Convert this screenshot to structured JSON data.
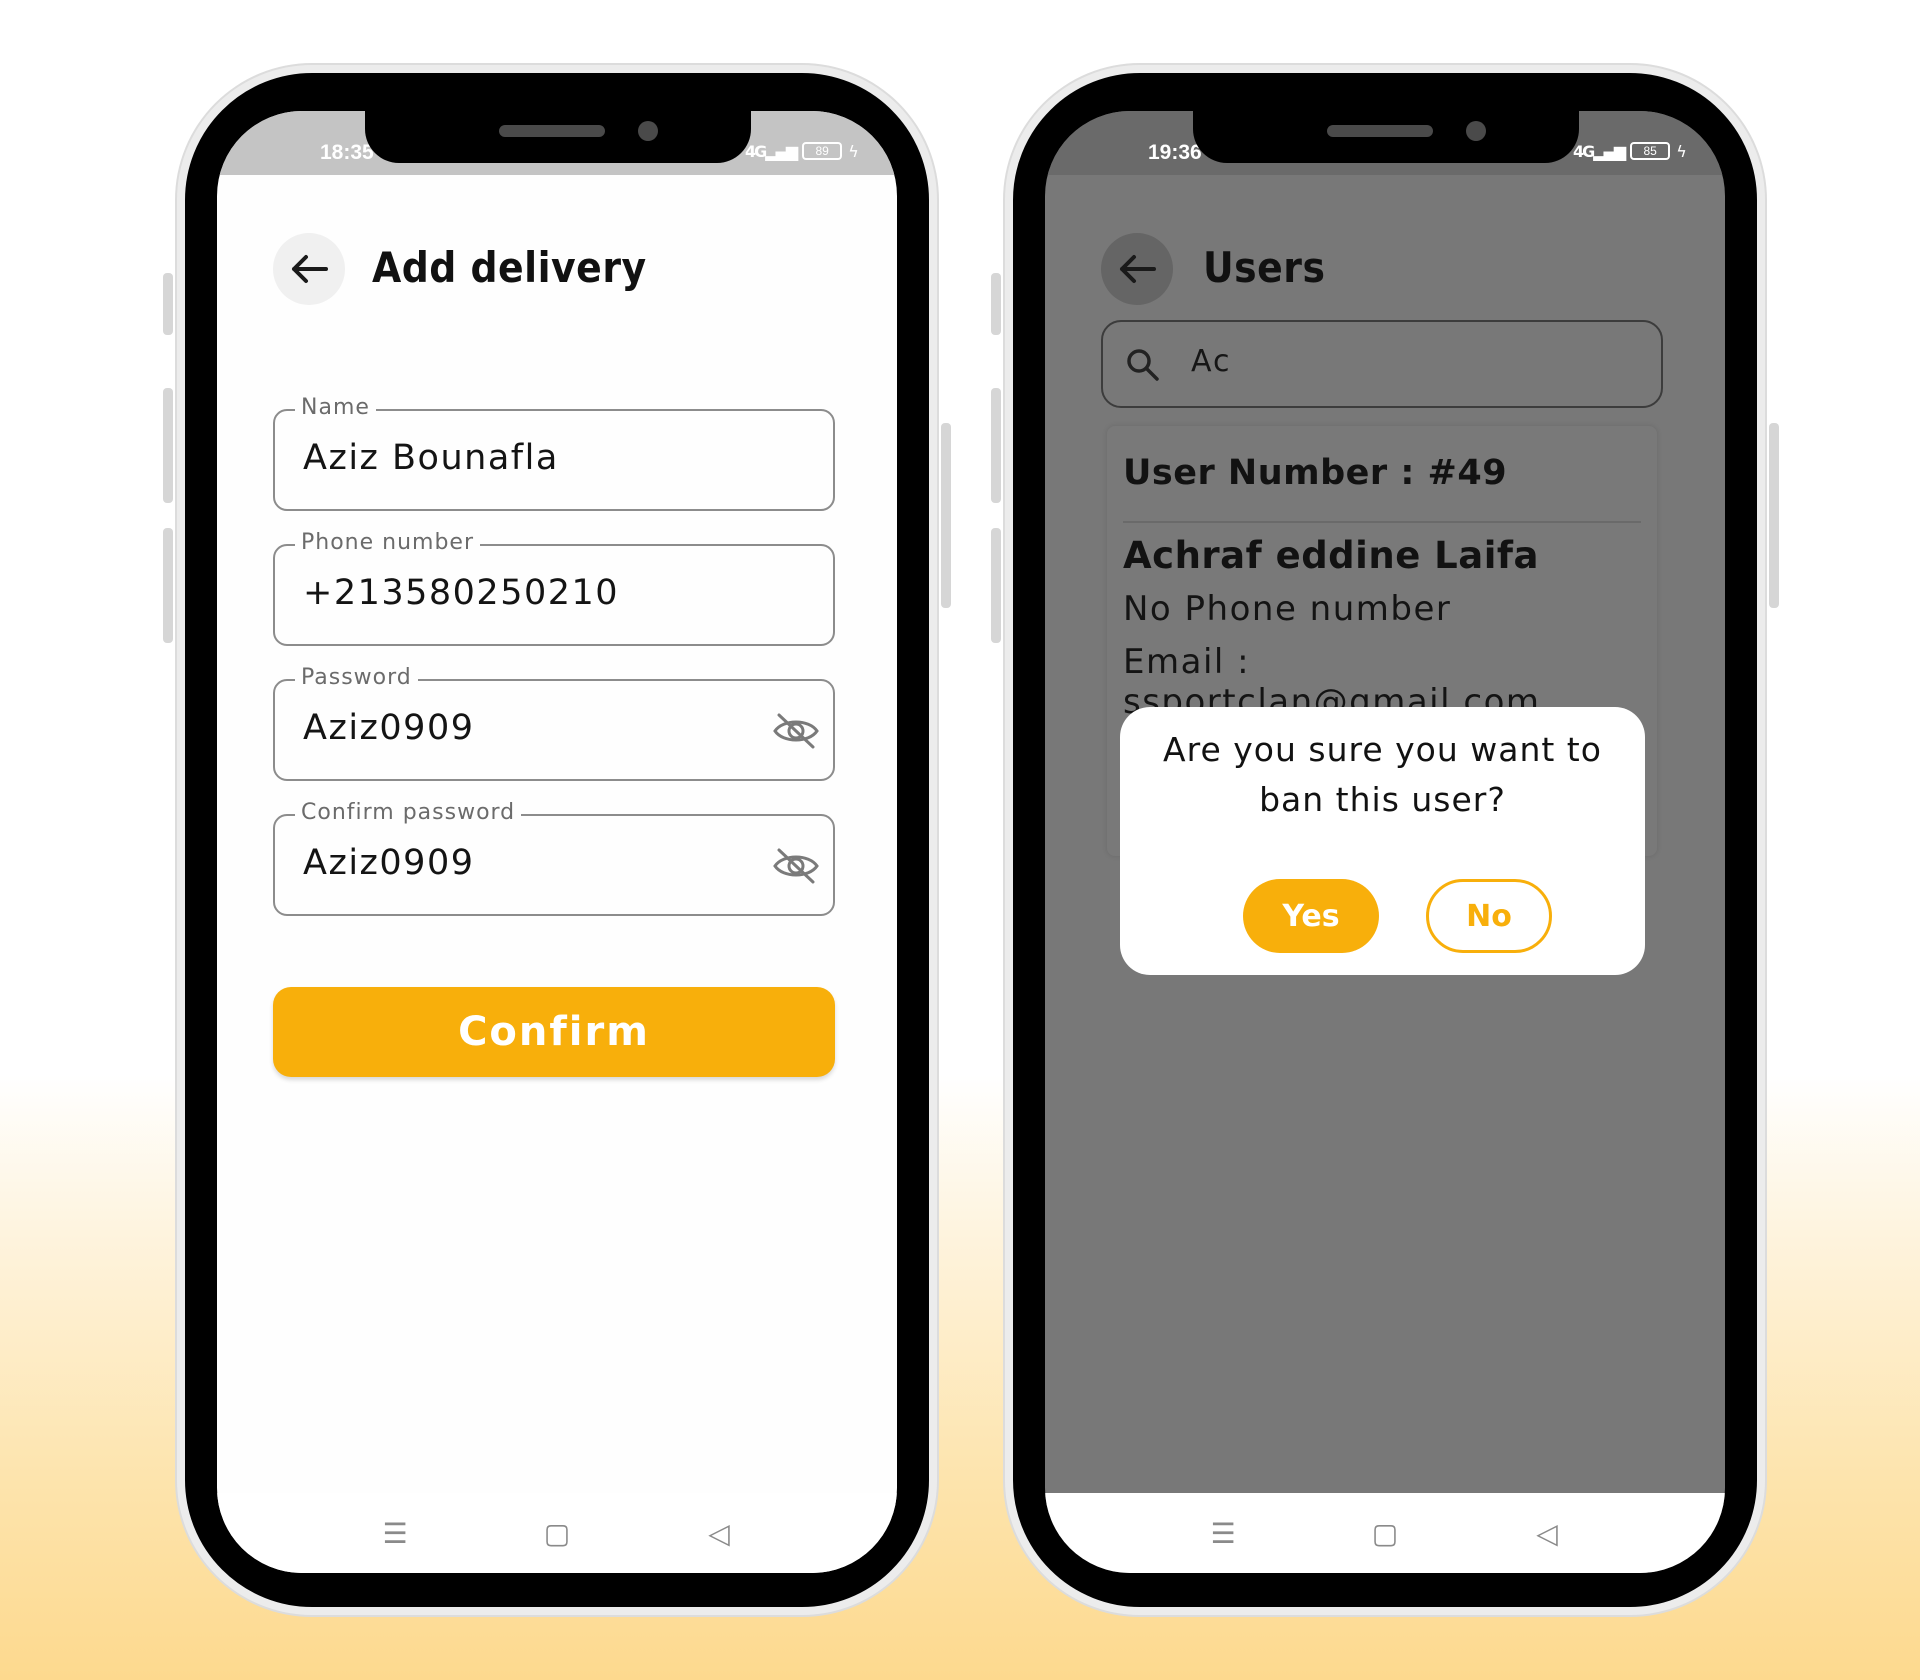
{
  "left_phone": {
    "status": {
      "time": "18:35",
      "network": "4G",
      "battery": "89"
    },
    "header": {
      "title": "Add delivery",
      "back_icon": "arrow-left-icon"
    },
    "fields": [
      {
        "label": "Name",
        "value": "Aziz Bounafla"
      },
      {
        "label": "Phone number",
        "value": "+213580250210"
      },
      {
        "label": "Password",
        "value": "Aziz0909",
        "icon": "eye-off-icon"
      },
      {
        "label": "Confirm password",
        "value": "Aziz0909",
        "icon": "eye-off-icon"
      }
    ],
    "confirm_label": "Confirm",
    "nav": {
      "menu": "☰",
      "home": "▢",
      "back": "◁"
    }
  },
  "right_phone": {
    "status": {
      "time": "19:36",
      "network": "4G",
      "battery": "85"
    },
    "header": {
      "title": "Users",
      "back_icon": "arrow-left-icon"
    },
    "search": {
      "value": "Ac",
      "icon": "search-icon"
    },
    "user_card": {
      "number": "User Number : #49",
      "name": "Achraf eddine Laifa",
      "phone": "No Phone number",
      "email": "Email : ssportclan@gmail.com"
    },
    "dialog": {
      "message": "Are you sure you want to ban this user?",
      "yes_label": "Yes",
      "no_label": "No"
    },
    "nav": {
      "menu": "☰",
      "home": "▢",
      "back": "◁"
    }
  },
  "colors": {
    "accent": "#f8af0b",
    "overlay": "#787878",
    "background_gradient_end": "#fdd98e"
  }
}
